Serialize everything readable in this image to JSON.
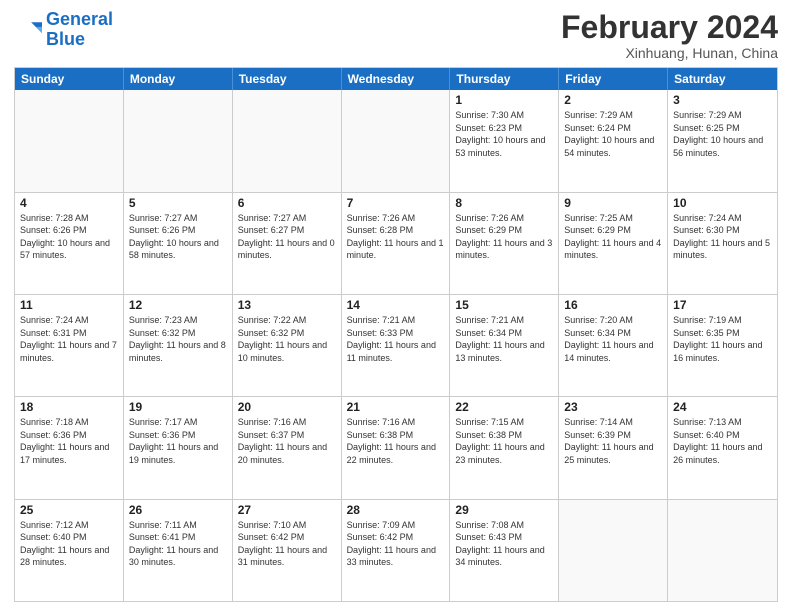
{
  "header": {
    "logo_general": "General",
    "logo_blue": "Blue",
    "month_title": "February 2024",
    "subtitle": "Xinhuang, Hunan, China"
  },
  "weekdays": [
    "Sunday",
    "Monday",
    "Tuesday",
    "Wednesday",
    "Thursday",
    "Friday",
    "Saturday"
  ],
  "rows": [
    [
      {
        "day": "",
        "empty": true
      },
      {
        "day": "",
        "empty": true
      },
      {
        "day": "",
        "empty": true
      },
      {
        "day": "",
        "empty": true
      },
      {
        "day": "1",
        "sunrise": "7:30 AM",
        "sunset": "6:23 PM",
        "daylight": "10 hours and 53 minutes."
      },
      {
        "day": "2",
        "sunrise": "7:29 AM",
        "sunset": "6:24 PM",
        "daylight": "10 hours and 54 minutes."
      },
      {
        "day": "3",
        "sunrise": "7:29 AM",
        "sunset": "6:25 PM",
        "daylight": "10 hours and 56 minutes."
      }
    ],
    [
      {
        "day": "4",
        "sunrise": "7:28 AM",
        "sunset": "6:26 PM",
        "daylight": "10 hours and 57 minutes."
      },
      {
        "day": "5",
        "sunrise": "7:27 AM",
        "sunset": "6:26 PM",
        "daylight": "10 hours and 58 minutes."
      },
      {
        "day": "6",
        "sunrise": "7:27 AM",
        "sunset": "6:27 PM",
        "daylight": "11 hours and 0 minutes."
      },
      {
        "day": "7",
        "sunrise": "7:26 AM",
        "sunset": "6:28 PM",
        "daylight": "11 hours and 1 minute."
      },
      {
        "day": "8",
        "sunrise": "7:26 AM",
        "sunset": "6:29 PM",
        "daylight": "11 hours and 3 minutes."
      },
      {
        "day": "9",
        "sunrise": "7:25 AM",
        "sunset": "6:29 PM",
        "daylight": "11 hours and 4 minutes."
      },
      {
        "day": "10",
        "sunrise": "7:24 AM",
        "sunset": "6:30 PM",
        "daylight": "11 hours and 5 minutes."
      }
    ],
    [
      {
        "day": "11",
        "sunrise": "7:24 AM",
        "sunset": "6:31 PM",
        "daylight": "11 hours and 7 minutes."
      },
      {
        "day": "12",
        "sunrise": "7:23 AM",
        "sunset": "6:32 PM",
        "daylight": "11 hours and 8 minutes."
      },
      {
        "day": "13",
        "sunrise": "7:22 AM",
        "sunset": "6:32 PM",
        "daylight": "11 hours and 10 minutes."
      },
      {
        "day": "14",
        "sunrise": "7:21 AM",
        "sunset": "6:33 PM",
        "daylight": "11 hours and 11 minutes."
      },
      {
        "day": "15",
        "sunrise": "7:21 AM",
        "sunset": "6:34 PM",
        "daylight": "11 hours and 13 minutes."
      },
      {
        "day": "16",
        "sunrise": "7:20 AM",
        "sunset": "6:34 PM",
        "daylight": "11 hours and 14 minutes."
      },
      {
        "day": "17",
        "sunrise": "7:19 AM",
        "sunset": "6:35 PM",
        "daylight": "11 hours and 16 minutes."
      }
    ],
    [
      {
        "day": "18",
        "sunrise": "7:18 AM",
        "sunset": "6:36 PM",
        "daylight": "11 hours and 17 minutes."
      },
      {
        "day": "19",
        "sunrise": "7:17 AM",
        "sunset": "6:36 PM",
        "daylight": "11 hours and 19 minutes."
      },
      {
        "day": "20",
        "sunrise": "7:16 AM",
        "sunset": "6:37 PM",
        "daylight": "11 hours and 20 minutes."
      },
      {
        "day": "21",
        "sunrise": "7:16 AM",
        "sunset": "6:38 PM",
        "daylight": "11 hours and 22 minutes."
      },
      {
        "day": "22",
        "sunrise": "7:15 AM",
        "sunset": "6:38 PM",
        "daylight": "11 hours and 23 minutes."
      },
      {
        "day": "23",
        "sunrise": "7:14 AM",
        "sunset": "6:39 PM",
        "daylight": "11 hours and 25 minutes."
      },
      {
        "day": "24",
        "sunrise": "7:13 AM",
        "sunset": "6:40 PM",
        "daylight": "11 hours and 26 minutes."
      }
    ],
    [
      {
        "day": "25",
        "sunrise": "7:12 AM",
        "sunset": "6:40 PM",
        "daylight": "11 hours and 28 minutes."
      },
      {
        "day": "26",
        "sunrise": "7:11 AM",
        "sunset": "6:41 PM",
        "daylight": "11 hours and 30 minutes."
      },
      {
        "day": "27",
        "sunrise": "7:10 AM",
        "sunset": "6:42 PM",
        "daylight": "11 hours and 31 minutes."
      },
      {
        "day": "28",
        "sunrise": "7:09 AM",
        "sunset": "6:42 PM",
        "daylight": "11 hours and 33 minutes."
      },
      {
        "day": "29",
        "sunrise": "7:08 AM",
        "sunset": "6:43 PM",
        "daylight": "11 hours and 34 minutes."
      },
      {
        "day": "",
        "empty": true
      },
      {
        "day": "",
        "empty": true
      }
    ]
  ]
}
